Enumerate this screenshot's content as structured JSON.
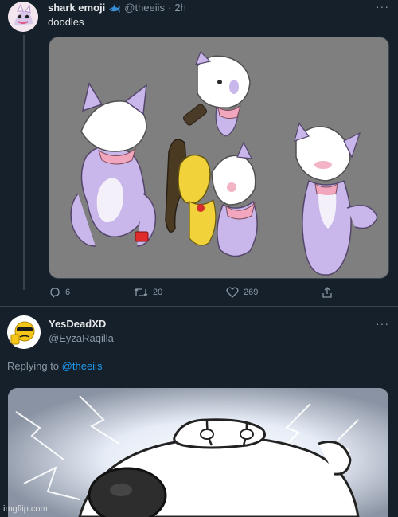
{
  "tweet1": {
    "display_name": "shark emoji",
    "handle": "@theeiis",
    "separator": "·",
    "time": "2h",
    "text": "doodles",
    "stats": {
      "replies": "6",
      "retweets": "20",
      "likes": "269"
    }
  },
  "tweet2": {
    "display_name": "YesDeadXD",
    "handle": "@EyzaRaqilla",
    "replying_prefix": "Replying to",
    "replying_to": "@theeiis"
  },
  "icons": {
    "verified_emoji": "shark-emoji-icon",
    "more": "more-icon",
    "reply": "reply-icon",
    "retweet": "retweet-icon",
    "like": "heart-icon",
    "share": "share-icon"
  },
  "watermark": "imgflip.com",
  "colors": {
    "background": "#15202b",
    "accent": "#1d9bf0",
    "muted": "#8b98a5"
  }
}
